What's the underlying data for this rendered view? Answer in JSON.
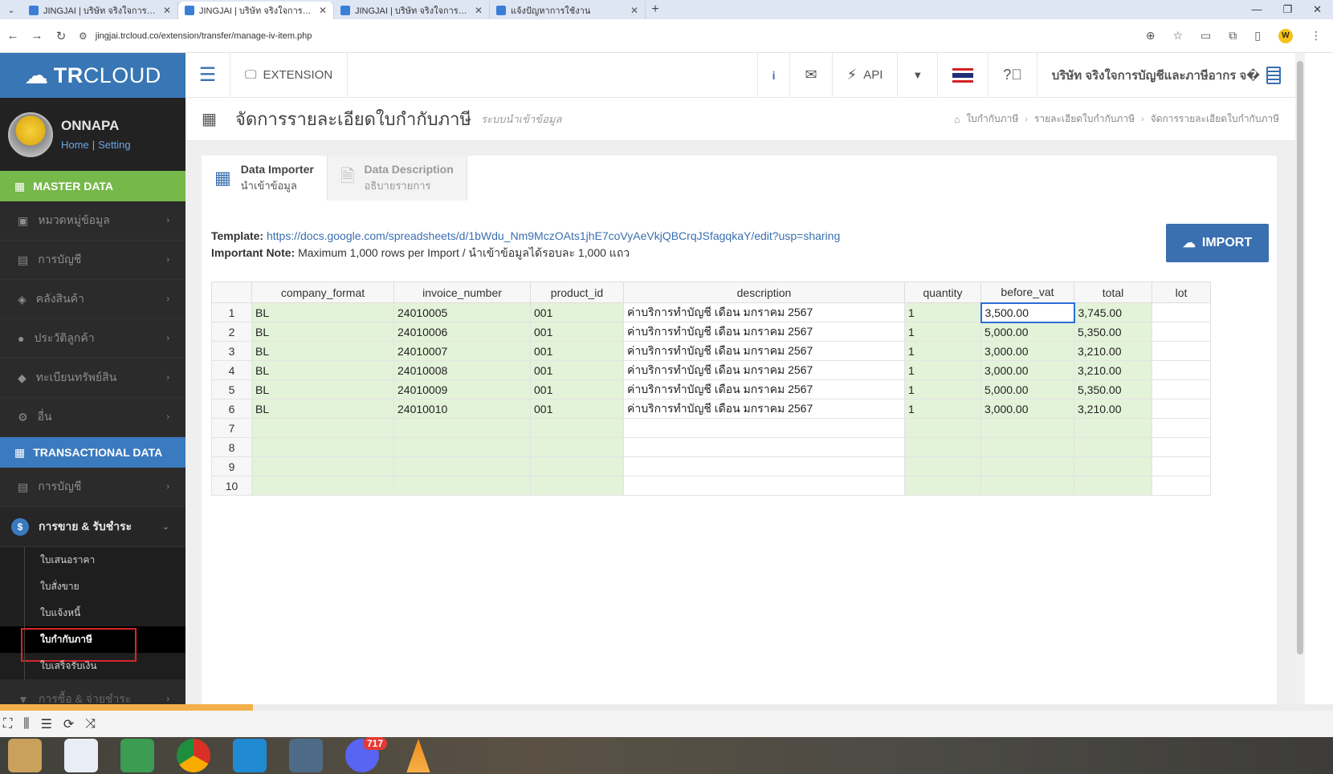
{
  "browser": {
    "tabs": [
      {
        "title": "JINGJAI | บริษัท จริงใจการบัญชีและ",
        "active": false
      },
      {
        "title": "JINGJAI | บริษัท จริงใจการบัญชีและ",
        "active": true
      },
      {
        "title": "JINGJAI | บริษัท จริงใจการบัญชีและ",
        "active": false
      },
      {
        "title": "แจ้งปัญหาการใช้งาน",
        "active": false
      }
    ],
    "url": "jingjai.trcloud.co/extension/transfer/manage-iv-item.php",
    "profile_initial": "W"
  },
  "brand": {
    "logo_bold": "TR",
    "logo_rest": "CLOUD"
  },
  "user": {
    "name": "ONNAPA",
    "home_link": "Home",
    "setting_link": "Setting"
  },
  "sidebar": {
    "master_title": "MASTER DATA",
    "master_items": [
      "หมวดหมู่ข้อมูล",
      "การบัญชี",
      "คลังสินค้า",
      "ประวัติลูกค้า",
      "ทะเบียนทรัพย์สิน",
      "อื่น"
    ],
    "trans_title": "TRANSACTIONAL DATA",
    "trans_item": "การบัญชี",
    "open_section": "การขาย & รับชำระ",
    "sub_items": [
      "ใบเสนอราคา",
      "ใบสั่งขาย",
      "ใบแจ้งหนี้",
      "ใบกำกับภาษี",
      "ใบเสร็จรับเงิน"
    ],
    "last_item": "การซื้อ & จ่ายชำระ"
  },
  "topnav": {
    "extension_label": "EXTENSION",
    "info_label": "i",
    "api_label": "API",
    "company": "บริษัท จริงใจการบัญชีและภาษีอากร จ�"
  },
  "page": {
    "title": "จัดการรายละเอียดใบกำกับภาษี",
    "subtitle": "ระบบนำเข้าข้อมูล",
    "breadcrumb": [
      "ใบกำกับภาษี",
      "รายละเอียดใบกำกับภาษี",
      "จัดการรายละเอียดใบกำกับภาษี"
    ]
  },
  "tabs": [
    {
      "title": "Data Importer",
      "subtitle": "นำเข้าข้อมูล"
    },
    {
      "title": "Data Description",
      "subtitle": "อธิบายรายการ"
    }
  ],
  "info": {
    "template_label": "Template:",
    "template_url": "https://docs.google.com/spreadsheets/d/1bWdu_Nm9MczOAts1jhE7coVyAeVkjQBCrqJSfagqkaY/edit?usp=sharing",
    "note_label": "Important Note:",
    "note_text": "Maximum 1,000 rows per Import / นำเข้าข้อมูลได้รอบละ 1,000 แถว"
  },
  "import_button": "IMPORT",
  "sheet": {
    "columns": [
      "company_format",
      "invoice_number",
      "product_id",
      "description",
      "quantity",
      "before_vat",
      "total",
      "lot"
    ],
    "row_numbers": [
      "1",
      "2",
      "3",
      "4",
      "5",
      "6",
      "7",
      "8",
      "9",
      "10"
    ],
    "rows": [
      [
        "BL",
        "24010005",
        "001",
        "ค่าบริการทำบัญชี เดือน มกราคม 2567",
        "1",
        "3,500.00",
        "3,745.00",
        ""
      ],
      [
        "BL",
        "24010006",
        "001",
        "ค่าบริการทำบัญชี เดือน มกราคม 2567",
        "1",
        "5,000.00",
        "5,350.00",
        ""
      ],
      [
        "BL",
        "24010007",
        "001",
        "ค่าบริการทำบัญชี เดือน มกราคม 2567",
        "1",
        "3,000.00",
        "3,210.00",
        ""
      ],
      [
        "BL",
        "24010008",
        "001",
        "ค่าบริการทำบัญชี เดือน มกราคม 2567",
        "1",
        "3,000.00",
        "3,210.00",
        ""
      ],
      [
        "BL",
        "24010009",
        "001",
        "ค่าบริการทำบัญชี เดือน มกราคม 2567",
        "1",
        "5,000.00",
        "5,350.00",
        ""
      ],
      [
        "BL",
        "24010010",
        "001",
        "ค่าบริการทำบัญชี เดือน มกราคม 2567",
        "1",
        "3,000.00",
        "3,210.00",
        ""
      ],
      [
        "",
        "",
        "",
        "",
        "",
        "",
        "",
        ""
      ],
      [
        "",
        "",
        "",
        "",
        "",
        "",
        "",
        ""
      ],
      [
        "",
        "",
        "",
        "",
        "",
        "",
        "",
        ""
      ],
      [
        "",
        "",
        "",
        "",
        "",
        "",
        "",
        ""
      ]
    ]
  },
  "taskbar": {
    "notification_count": "717"
  },
  "colors": {
    "brand_blue": "#3a6fb0",
    "master_green": "#76b84a",
    "cell_green": "#e3f3d9",
    "selected_red": "#d9262b"
  }
}
